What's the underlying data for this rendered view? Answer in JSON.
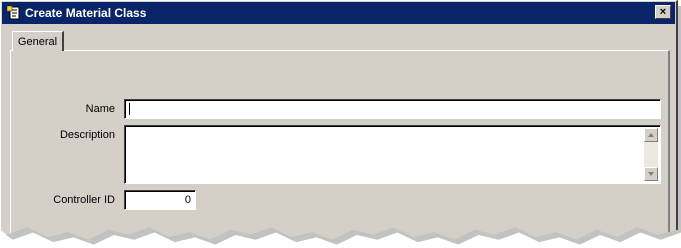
{
  "window": {
    "title": "Create Material Class",
    "close_label": "×"
  },
  "tabs": [
    {
      "label": "General"
    }
  ],
  "form": {
    "name_label": "Name",
    "name_value": "",
    "description_label": "Description",
    "description_value": "",
    "controller_id_label": "Controller ID",
    "controller_id_value": "0"
  },
  "icons": {
    "title": "document-icon",
    "close": "close-icon",
    "scroll_up": "scroll-up-arrow-icon",
    "scroll_down": "scroll-down-arrow-icon"
  },
  "colors": {
    "titlebar": "#0a246a",
    "face": "#d4d0c8"
  }
}
